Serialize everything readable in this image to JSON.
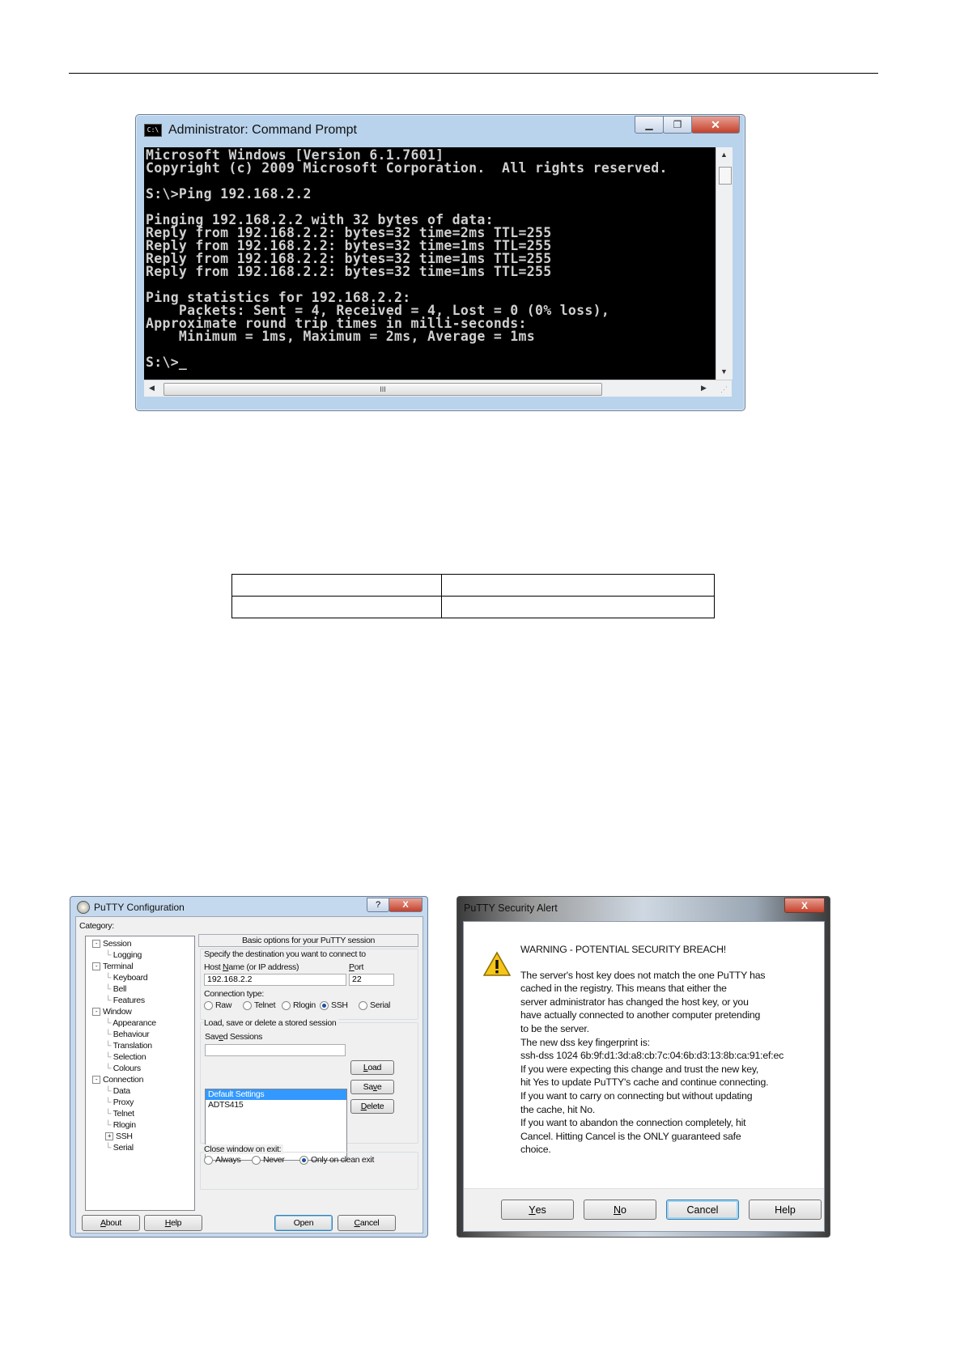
{
  "cmd": {
    "title": "Administrator: Command Prompt",
    "app_icon_text": "C:\\",
    "lines": [
      "Microsoft Windows [Version 6.1.7601]",
      "Copyright (c) 2009 Microsoft Corporation.  All rights reserved.",
      "",
      "S:\\>Ping 192.168.2.2",
      "",
      "Pinging 192.168.2.2 with 32 bytes of data:",
      "Reply from 192.168.2.2: bytes=32 time=2ms TTL=255",
      "Reply from 192.168.2.2: bytes=32 time=1ms TTL=255",
      "Reply from 192.168.2.2: bytes=32 time=1ms TTL=255",
      "Reply from 192.168.2.2: bytes=32 time=1ms TTL=255",
      "",
      "Ping statistics for 192.168.2.2:",
      "    Packets: Sent = 4, Received = 4, Lost = 0 (0% loss),",
      "Approximate round trip times in milli-seconds:",
      "    Minimum = 1ms, Maximum = 2ms, Average = 1ms",
      "",
      "S:\\>_"
    ],
    "hscroll_grip": "III"
  },
  "putty_config": {
    "title": "PuTTY Configuration",
    "help_btn": "?",
    "close_btn": "X",
    "category_label": "Category:",
    "tree": [
      {
        "label": "Session",
        "level": 0,
        "toggle": "-"
      },
      {
        "label": "Logging",
        "level": 1
      },
      {
        "label": "Terminal",
        "level": 0,
        "toggle": "-"
      },
      {
        "label": "Keyboard",
        "level": 1
      },
      {
        "label": "Bell",
        "level": 1
      },
      {
        "label": "Features",
        "level": 1
      },
      {
        "label": "Window",
        "level": 0,
        "toggle": "-"
      },
      {
        "label": "Appearance",
        "level": 1
      },
      {
        "label": "Behaviour",
        "level": 1
      },
      {
        "label": "Translation",
        "level": 1
      },
      {
        "label": "Selection",
        "level": 1
      },
      {
        "label": "Colours",
        "level": 1
      },
      {
        "label": "Connection",
        "level": 0,
        "toggle": "-"
      },
      {
        "label": "Data",
        "level": 1
      },
      {
        "label": "Proxy",
        "level": 1
      },
      {
        "label": "Telnet",
        "level": 1
      },
      {
        "label": "Rlogin",
        "level": 1
      },
      {
        "label": "SSH",
        "level": 1,
        "toggle": "+"
      },
      {
        "label": "Serial",
        "level": 1
      }
    ],
    "panel_header": "Basic options for your PuTTY session",
    "dest_label": "Specify the destination you want to connect to",
    "host_label": "Host Name (or IP address)",
    "port_label": "Port",
    "host_value": "192.168.2.2",
    "port_value": "22",
    "conn_type_label": "Connection type:",
    "conn_types": [
      "Raw",
      "Telnet",
      "Rlogin",
      "SSH",
      "Serial"
    ],
    "conn_type_selected": "SSH",
    "session_group_label": "Load, save or delete a stored session",
    "saved_sessions_label": "Saved Sessions",
    "saved_sessions_value": "",
    "sessions": [
      "Default Settings",
      "ADTS415"
    ],
    "selected_session": "Default Settings",
    "load_btn": "Load",
    "save_btn": "Save",
    "delete_btn": "Delete",
    "close_window_label": "Close window on exit:",
    "close_options": [
      "Always",
      "Never",
      "Only on clean exit"
    ],
    "close_selected": "Only on clean exit",
    "about_btn": "About",
    "help_btn2": "Help",
    "open_btn": "Open",
    "cancel_btn": "Cancel"
  },
  "security_alert": {
    "title": "PuTTY Security Alert",
    "close_btn": "X",
    "lines": [
      "WARNING - POTENTIAL SECURITY BREACH!",
      "",
      "The server's host key does not match the one PuTTY has",
      "cached in the registry. This means that either the",
      "server administrator has changed the host key, or you",
      "have actually connected to another computer pretending",
      "to be the server.",
      "The new dss key fingerprint is:",
      "ssh-dss 1024 6b:9f:d1:3d:a8:cb:7c:04:6b:d3:13:8b:ca:91:ef:ec",
      "If you were expecting this change and trust the new key,",
      "hit Yes to update PuTTY's cache and continue connecting.",
      "If you want to carry on connecting but without updating",
      "the cache, hit No.",
      "If you want to abandon the connection completely, hit",
      "Cancel. Hitting Cancel is the ONLY guaranteed safe",
      "choice."
    ],
    "yes_btn": "Yes",
    "no_btn": "No",
    "cancel_btn": "Cancel",
    "help_btn": "Help"
  },
  "colors": {
    "console_bg": "#000000",
    "console_fg": "#cfcfcf",
    "selection": "#3399ff",
    "close_red": "#c4412b"
  }
}
